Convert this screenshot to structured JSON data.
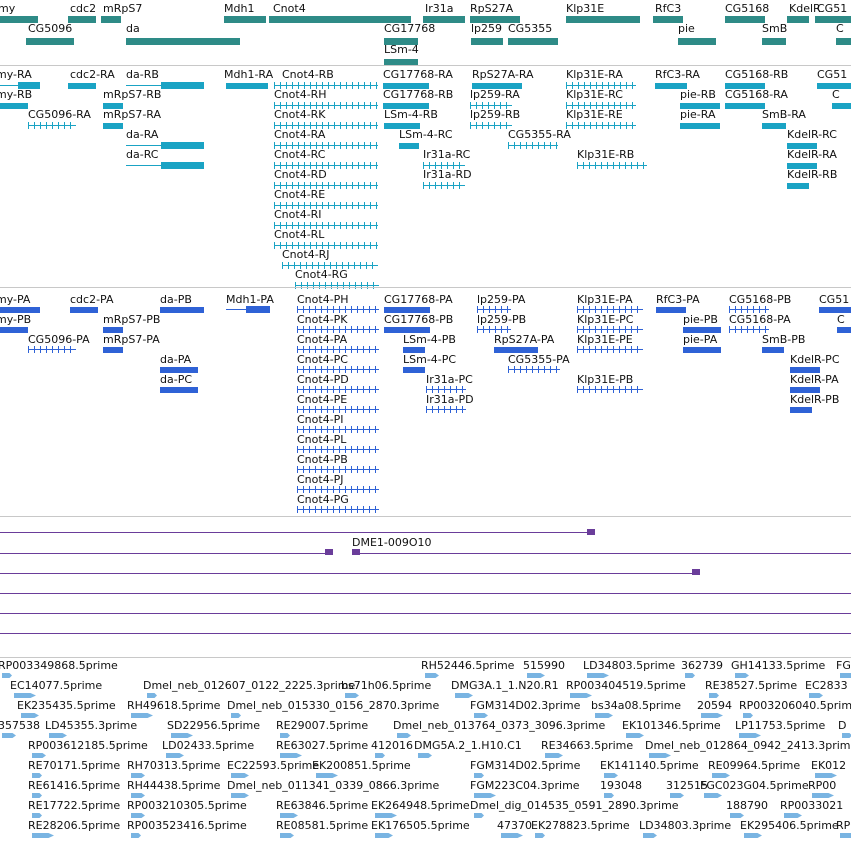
{
  "colors": {
    "gene": "#2e8b87",
    "rna": "#1aa3c4",
    "protein": "#2f62d6",
    "contig": "#6a3d9a",
    "est": "#79b4e2",
    "sep": "#c8c8c8"
  },
  "tracks": {
    "genes": [
      {
        "label": "my"
      },
      {
        "label": "cdc2"
      },
      {
        "label": "mRpS7"
      },
      {
        "label": "Mdh1"
      },
      {
        "label": "Cnot4"
      },
      {
        "label": "Ir31a"
      },
      {
        "label": "RpS27A"
      },
      {
        "label": "Klp31E"
      },
      {
        "label": "RfC3"
      },
      {
        "label": "CG5168"
      },
      {
        "label": "KdelR"
      },
      {
        "label": "CG51"
      },
      {
        "label": "CG5096"
      },
      {
        "label": "da"
      },
      {
        "label": "CG17768"
      },
      {
        "label": "lp259"
      },
      {
        "label": "CG5355"
      },
      {
        "label": "pie"
      },
      {
        "label": "SmB"
      },
      {
        "label": "C"
      },
      {
        "label": "LSm-4"
      }
    ],
    "transcripts": [
      {
        "label": "my-RA"
      },
      {
        "label": "cdc2-RA"
      },
      {
        "label": "da-RB"
      },
      {
        "label": "Mdh1-RA"
      },
      {
        "label": "Cnot4-RB"
      },
      {
        "label": "CG17768-RA"
      },
      {
        "label": "RpS27A-RA"
      },
      {
        "label": "Klp31E-RA"
      },
      {
        "label": "RfC3-RA"
      },
      {
        "label": "CG5168-RB"
      },
      {
        "label": "CG51"
      },
      {
        "label": "my-RB"
      },
      {
        "label": "mRpS7-RB"
      },
      {
        "label": "Cnot4-RH"
      },
      {
        "label": "CG17768-RB"
      },
      {
        "label": "lp259-RA"
      },
      {
        "label": "Klp31E-RC"
      },
      {
        "label": "pie-RB"
      },
      {
        "label": "CG5168-RA"
      },
      {
        "label": "C"
      },
      {
        "label": "CG5096-RA"
      },
      {
        "label": "mRpS7-RA"
      },
      {
        "label": "Cnot4-RK"
      },
      {
        "label": "LSm-4-RB"
      },
      {
        "label": "lp259-RB"
      },
      {
        "label": "Klp31E-RE"
      },
      {
        "label": "pie-RA"
      },
      {
        "label": "SmB-RA"
      },
      {
        "label": "da-RA"
      },
      {
        "label": "Cnot4-RA"
      },
      {
        "label": "LSm-4-RC"
      },
      {
        "label": "CG5355-RA"
      },
      {
        "label": "KdelR-RC"
      },
      {
        "label": "da-RC"
      },
      {
        "label": "Cnot4-RC"
      },
      {
        "label": "Ir31a-RC"
      },
      {
        "label": "Klp31E-RB"
      },
      {
        "label": "KdelR-RA"
      },
      {
        "label": "Cnot4-RD"
      },
      {
        "label": "Ir31a-RD"
      },
      {
        "label": "KdelR-RB"
      },
      {
        "label": "Cnot4-RE"
      },
      {
        "label": "Cnot4-RI"
      },
      {
        "label": "Cnot4-RL"
      },
      {
        "label": "Cnot4-RJ"
      },
      {
        "label": "Cnot4-RG"
      }
    ],
    "proteins": [
      {
        "label": "my-PA"
      },
      {
        "label": "cdc2-PA"
      },
      {
        "label": "da-PB"
      },
      {
        "label": "Mdh1-PA"
      },
      {
        "label": "Cnot4-PH"
      },
      {
        "label": "CG17768-PA"
      },
      {
        "label": "lp259-PA"
      },
      {
        "label": "Klp31E-PA"
      },
      {
        "label": "RfC3-PA"
      },
      {
        "label": "CG5168-PB"
      },
      {
        "label": "CG51"
      },
      {
        "label": "my-PB"
      },
      {
        "label": "mRpS7-PB"
      },
      {
        "label": "Cnot4-PK"
      },
      {
        "label": "CG17768-PB"
      },
      {
        "label": "lp259-PB"
      },
      {
        "label": "Klp31E-PC"
      },
      {
        "label": "pie-PB"
      },
      {
        "label": "CG5168-PA"
      },
      {
        "label": "C"
      },
      {
        "label": "CG5096-PA"
      },
      {
        "label": "mRpS7-PA"
      },
      {
        "label": "Cnot4-PA"
      },
      {
        "label": "LSm-4-PB"
      },
      {
        "label": "RpS27A-PA"
      },
      {
        "label": "Klp31E-PE"
      },
      {
        "label": "pie-PA"
      },
      {
        "label": "SmB-PB"
      },
      {
        "label": "da-PA"
      },
      {
        "label": "Cnot4-PC"
      },
      {
        "label": "LSm-4-PC"
      },
      {
        "label": "CG5355-PA"
      },
      {
        "label": "KdelR-PC"
      },
      {
        "label": "da-PC"
      },
      {
        "label": "Cnot4-PD"
      },
      {
        "label": "Ir31a-PC"
      },
      {
        "label": "Klp31E-PB"
      },
      {
        "label": "KdelR-PA"
      },
      {
        "label": "Cnot4-PE"
      },
      {
        "label": "Ir31a-PD"
      },
      {
        "label": "KdelR-PB"
      },
      {
        "label": "Cnot4-PI"
      },
      {
        "label": "Cnot4-PL"
      },
      {
        "label": "Cnot4-PB"
      },
      {
        "label": "Cnot4-PJ"
      },
      {
        "label": "Cnot4-PG"
      }
    ],
    "contigs": [
      {
        "label": "DME1-009O10"
      }
    ],
    "ests": [
      {
        "label": "RP003349868.5prime"
      },
      {
        "label": "RH52446.5prime"
      },
      {
        "label": "515990"
      },
      {
        "label": "LD34803.5prime"
      },
      {
        "label": "362739"
      },
      {
        "label": "GH14133.5prime"
      },
      {
        "label": "FG"
      },
      {
        "label": "EC14077.5prime"
      },
      {
        "label": "Dmel_neb_012607_0122_2225.3prime"
      },
      {
        "label": "bs71h06.5prime"
      },
      {
        "label": "DMG3A.1_1.N20.R1"
      },
      {
        "label": "RP003404519.5prime"
      },
      {
        "label": "RE38527.5prime"
      },
      {
        "label": "EC2833"
      },
      {
        "label": "EK235435.5prime"
      },
      {
        "label": "RH49618.5prime"
      },
      {
        "label": "Dmel_neb_015330_0156_2870.3prime"
      },
      {
        "label": "FGM314D02.3prime"
      },
      {
        "label": "bs34a08.5prime"
      },
      {
        "label": "20594"
      },
      {
        "label": "RP003206040.5prime"
      },
      {
        "label": "357538"
      },
      {
        "label": "LD45355.3prime"
      },
      {
        "label": "SD22956.5prime"
      },
      {
        "label": "RE29007.5prime"
      },
      {
        "label": "Dmel_neb_013764_0373_3096.3prime"
      },
      {
        "label": "EK101346.5prime"
      },
      {
        "label": "LP11753.5prime"
      },
      {
        "label": "D"
      },
      {
        "label": "RP003612185.5prime"
      },
      {
        "label": "LD02433.5prime"
      },
      {
        "label": "RE63027.5prime"
      },
      {
        "label": "412016"
      },
      {
        "label": "DMG5A.2_1.H10.C1"
      },
      {
        "label": "RE34663.5prime"
      },
      {
        "label": "Dmel_neb_012864_0942_2413.3prime"
      },
      {
        "label": "RE70171.5prime"
      },
      {
        "label": "RH70313.5prime"
      },
      {
        "label": "EC22593.5prime"
      },
      {
        "label": "EK200851.5prime"
      },
      {
        "label": "FGM314D02.5prime"
      },
      {
        "label": "EK141140.5prime"
      },
      {
        "label": "RE09964.5prime"
      },
      {
        "label": "EK012"
      },
      {
        "label": "RE61416.5prime"
      },
      {
        "label": "RH44438.5prime"
      },
      {
        "label": "Dmel_neb_011341_0339_0866.3prime"
      },
      {
        "label": "FGM223C04.3prime"
      },
      {
        "label": "193048"
      },
      {
        "label": "312515"
      },
      {
        "label": "FGC023G04.5prime"
      },
      {
        "label": "RP00"
      },
      {
        "label": "RE17722.5prime"
      },
      {
        "label": "RP003210305.5prime"
      },
      {
        "label": "RE63846.5prime"
      },
      {
        "label": "EK264948.5prime"
      },
      {
        "label": "Dmel_dig_014535_0591_2890.3prime"
      },
      {
        "label": "188790"
      },
      {
        "label": "RP0033021"
      },
      {
        "label": "RE28206.5prime"
      },
      {
        "label": "RP003523416.5prime"
      },
      {
        "label": "RE08581.5prime"
      },
      {
        "label": "EK176505.5prime"
      },
      {
        "label": "47370"
      },
      {
        "label": "EK278823.5prime"
      },
      {
        "label": "LD34803.3prime"
      },
      {
        "label": "EK295406.5prime"
      },
      {
        "label": "RP0"
      }
    ]
  }
}
